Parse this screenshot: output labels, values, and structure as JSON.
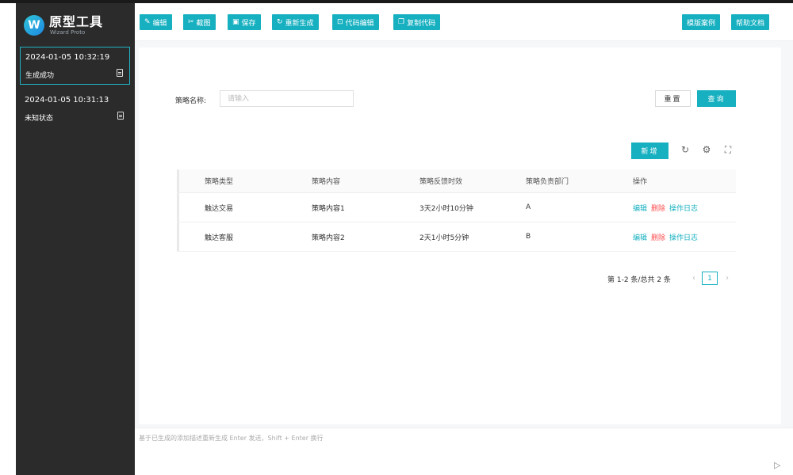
{
  "app": {
    "logo_letter": "W",
    "title": "原型工具",
    "subtitle": "Wizard Proto"
  },
  "history": [
    {
      "time": "2024-01-05 10:32:19",
      "status": "生成成功",
      "active": true
    },
    {
      "time": "2024-01-05 10:31:13",
      "status": "未知状态",
      "active": false
    }
  ],
  "toolbar": {
    "edit": "编辑",
    "screenshot": "截图",
    "save": "保存",
    "regenerate": "重新生成",
    "code_edit": "代码编辑",
    "copy_code": "复制代码",
    "templates": "模版案例",
    "help": "帮助文档"
  },
  "search": {
    "label": "策略名称:",
    "placeholder": "请输入",
    "value": "",
    "reset": "重置",
    "query": "查询"
  },
  "table_actions": {
    "add": "新增"
  },
  "table": {
    "columns": [
      "策略类型",
      "策略内容",
      "策略反馈时效",
      "策略负责部门",
      "操作"
    ],
    "rows": [
      [
        "触达交易",
        "策略内容1",
        "3天2小时10分钟",
        "A"
      ],
      [
        "触达客服",
        "策略内容2",
        "2天1小时5分钟",
        "B"
      ]
    ],
    "ops": {
      "edit": "编辑",
      "delete": "删除",
      "log": "操作日志"
    }
  },
  "pagination": {
    "summary": "第 1-2 条/总共 2 条",
    "current": "1"
  },
  "prompt": {
    "placeholder": "基于已生成的添加描述重新生成 Enter 发送，Shift + Enter 换行"
  },
  "colors": {
    "accent": "#16b0c0",
    "sidebar": "#2b2b2b",
    "danger": "#ff4d4f"
  }
}
